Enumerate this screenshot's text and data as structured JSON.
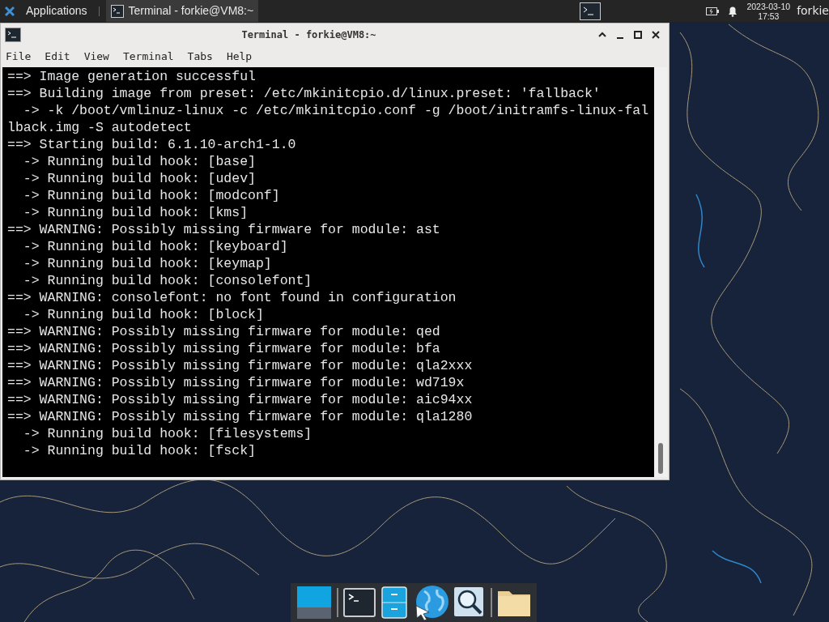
{
  "top_panel": {
    "applications": "Applications",
    "task": {
      "label": "Terminal - forkie@VM8:~",
      "selected": true
    },
    "date": "2023-03-10",
    "time": "17:53",
    "user": "forkie"
  },
  "window": {
    "title": "Terminal - forkie@VM8:~",
    "menu": [
      "File",
      "Edit",
      "View",
      "Terminal",
      "Tabs",
      "Help"
    ],
    "lines": [
      "==> Image generation successful",
      "==> Building image from preset: /etc/mkinitcpio.d/linux.preset: 'fallback'",
      "  -> -k /boot/vmlinuz-linux -c /etc/mkinitcpio.conf -g /boot/initramfs-linux-fal",
      "lback.img -S autodetect",
      "==> Starting build: 6.1.10-arch1-1.0",
      "  -> Running build hook: [base]",
      "  -> Running build hook: [udev]",
      "  -> Running build hook: [modconf]",
      "  -> Running build hook: [kms]",
      "==> WARNING: Possibly missing firmware for module: ast",
      "  -> Running build hook: [keyboard]",
      "  -> Running build hook: [keymap]",
      "  -> Running build hook: [consolefont]",
      "==> WARNING: consolefont: no font found in configuration",
      "  -> Running build hook: [block]",
      "==> WARNING: Possibly missing firmware for module: qed",
      "==> WARNING: Possibly missing firmware for module: bfa",
      "==> WARNING: Possibly missing firmware for module: qla2xxx",
      "==> WARNING: Possibly missing firmware for module: wd719x",
      "==> WARNING: Possibly missing firmware for module: aic94xx",
      "==> WARNING: Possibly missing firmware for module: qla1280",
      "  -> Running build hook: [filesystems]",
      "  -> Running build hook: [fsck]"
    ]
  },
  "dock": [
    {
      "kind": "desktop"
    },
    {
      "kind": "terminal"
    },
    {
      "kind": "files"
    },
    {
      "kind": "browser"
    },
    {
      "kind": "search"
    },
    {
      "kind": "folder"
    }
  ]
}
